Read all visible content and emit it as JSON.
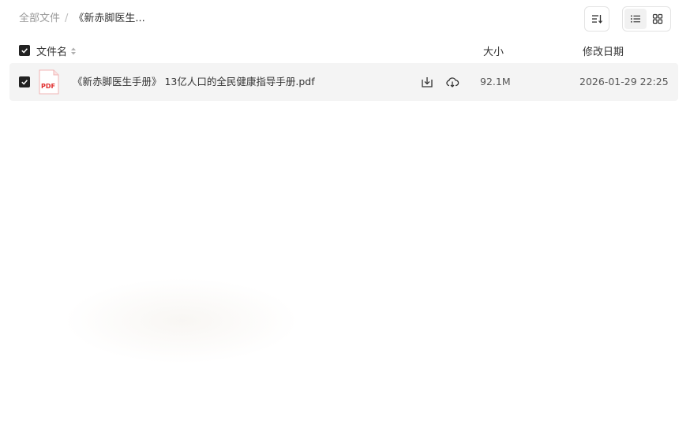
{
  "breadcrumb": {
    "root": "全部文件",
    "separator": "/",
    "current": "《新赤脚医生..."
  },
  "toolbar": {
    "sort_icon": "sort-icon",
    "view_list_icon": "list-view-icon",
    "view_grid_icon": "grid-view-icon",
    "active_view": "list"
  },
  "table": {
    "header": {
      "name": "文件名",
      "size": "大小",
      "date": "修改日期"
    },
    "rows": [
      {
        "icon": "pdf-file-icon",
        "icon_label": "PDF",
        "name": "《新赤脚医生手册》 13亿人口的全民健康指导手册.pdf",
        "size": "92.1M",
        "date": "2026-01-29 22:25",
        "checked": true
      }
    ]
  },
  "colors": {
    "row_bg": "#f4f4f4",
    "checkbox": "#222222",
    "pdf_red": "#e02d2d"
  }
}
